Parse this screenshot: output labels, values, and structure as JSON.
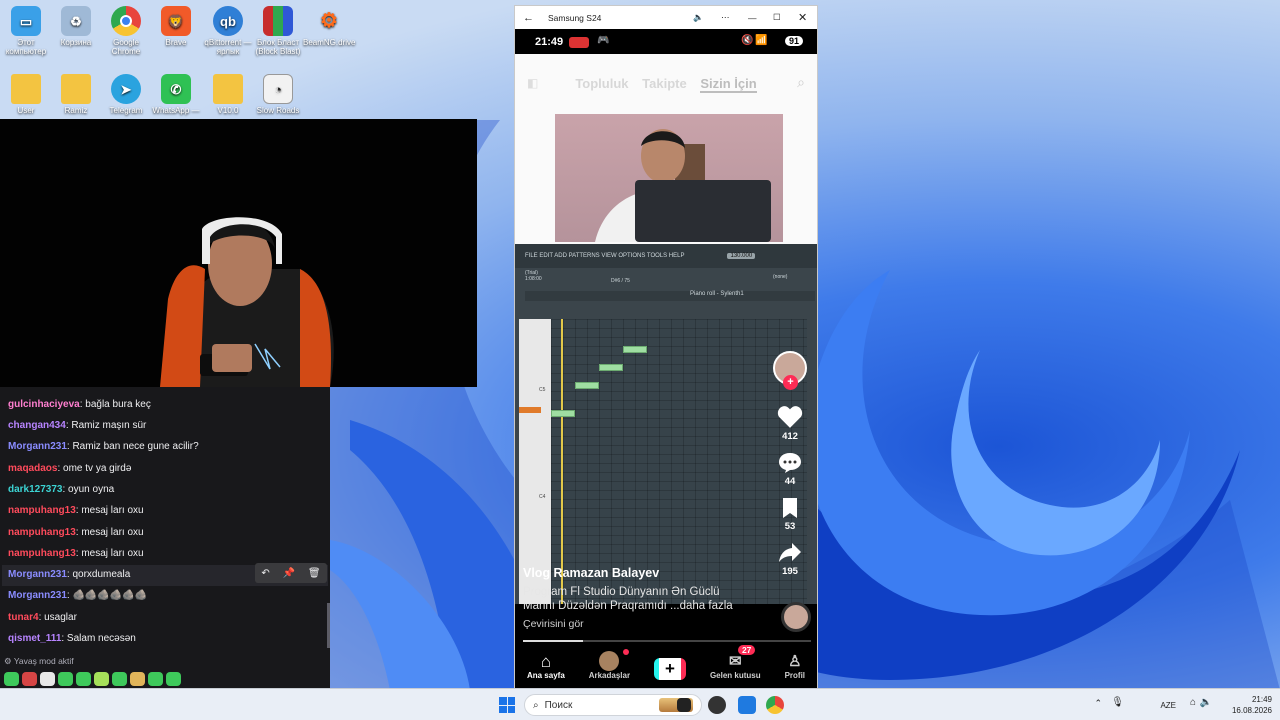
{
  "desktop": {
    "icons": [
      {
        "label": "Этот компьютер",
        "icon": "computer-icon",
        "color": "#3aa0e8"
      },
      {
        "label": "Корзина",
        "icon": "recycle-bin-icon",
        "color": "#9fb9d6"
      },
      {
        "label": "Google Chrome",
        "icon": "chrome-icon",
        "color": "#e8453c"
      },
      {
        "label": "Brave",
        "icon": "brave-icon",
        "color": "#f15a29"
      },
      {
        "label": "qBittorrent — ярлык",
        "icon": "qbittorrent-icon",
        "color": "#2f7fd6"
      },
      {
        "label": "Блок Бласт (Block Blast)",
        "icon": "block-blast-icon",
        "color": "#c72d2d"
      },
      {
        "label": "BeamNG.drive",
        "icon": "beamng-icon",
        "color": "#ff6b1a"
      },
      {
        "label": "User",
        "icon": "folder-icon",
        "color": "#f3c441"
      },
      {
        "label": "Ramiz",
        "icon": "folder-icon",
        "color": "#f3c441"
      },
      {
        "label": "Telegram",
        "icon": "telegram-icon",
        "color": "#2aa3df"
      },
      {
        "label": "WhatsApp —",
        "icon": "whatsapp-icon",
        "color": "#2fc154"
      },
      {
        "label": "V10.0",
        "icon": "folder-icon",
        "color": "#f3c441"
      },
      {
        "label": "Slow Roads",
        "icon": "slow-roads-icon",
        "color": "#e9e9e9"
      }
    ]
  },
  "chat": {
    "messages": [
      {
        "user": "gulcinhaciyeva",
        "text": ": bağla bura keç",
        "color": "#ff7fd0"
      },
      {
        "user": "changan434",
        "text": ": Ramiz maşın sür",
        "color": "#b784ff"
      },
      {
        "user": "Morgann231",
        "text": ": Ramiz ban nece gune acilir?",
        "color": "#8a8cff"
      },
      {
        "user": "maqadaos",
        "text": ": ome tv ya girdə",
        "color": "#ff4b5c"
      },
      {
        "user": "dark127373",
        "text": ": oyun oyna",
        "color": "#3cd3d3"
      },
      {
        "user": "nampuhang13",
        "text": ": mesaj ları oxu",
        "color": "#ff4b5c"
      },
      {
        "user": "nampuhang13",
        "text": ": mesaj ları oxu",
        "color": "#ff4b5c"
      },
      {
        "user": "nampuhang13",
        "text": ": mesaj ları oxu",
        "color": "#ff4b5c"
      },
      {
        "user": "Morgann231",
        "text": ": qorxdumeala",
        "color": "#8a8cff"
      },
      {
        "user": "Morgann231",
        "text": ": 🪨🪨🪨🪨🪨🪨",
        "color": "#8a8cff"
      },
      {
        "user": "tunar4",
        "text": ": usaglar",
        "color": "#ff4b5c"
      },
      {
        "user": "qismet_111",
        "text": ": Salam necəsən",
        "color": "#b784ff"
      }
    ],
    "slow_mode": "Yavaş mod aktif"
  },
  "phone": {
    "window_title": "Samsung S24",
    "status_time": "21:49",
    "battery": "91",
    "tabs": [
      "Topluluk",
      "Takipte",
      "Sizin İçin"
    ],
    "fl_menu": "FILE EDIT ADD PATTERNS VIEW OPTIONS TOOLS HELP",
    "fl_bpm": "130.000",
    "fl_trial": "(Trial)",
    "fl_piano_roll": "Piano roll - Sylenth1",
    "fl_none": "(none)",
    "fl_key_c5": "C5",
    "fl_key_c4": "C4",
    "fl_time": "1:08:00",
    "fl_pos": "D#6 / 75",
    "counts": {
      "likes": "412",
      "comments": "44",
      "saves": "53",
      "shares": "195"
    },
    "author": "Vlog Ramazan Balayev",
    "desc_line1": "Program Fl Studio Dünyanın Ən Güclü",
    "desc_line2": "Mahnı Düzəldən Praqramıdı ...daha fazla",
    "translate": "Çevirisini gör",
    "nav": {
      "home": "Ana sayfa",
      "friends": "Arkadaşlar",
      "inbox": "Gelen kutusu",
      "inbox_badge": "27",
      "profile": "Profil"
    }
  },
  "taskbar": {
    "search_placeholder": "Поиск",
    "lang": "AZE",
    "time": "21:49",
    "date": "16.08.2026"
  }
}
